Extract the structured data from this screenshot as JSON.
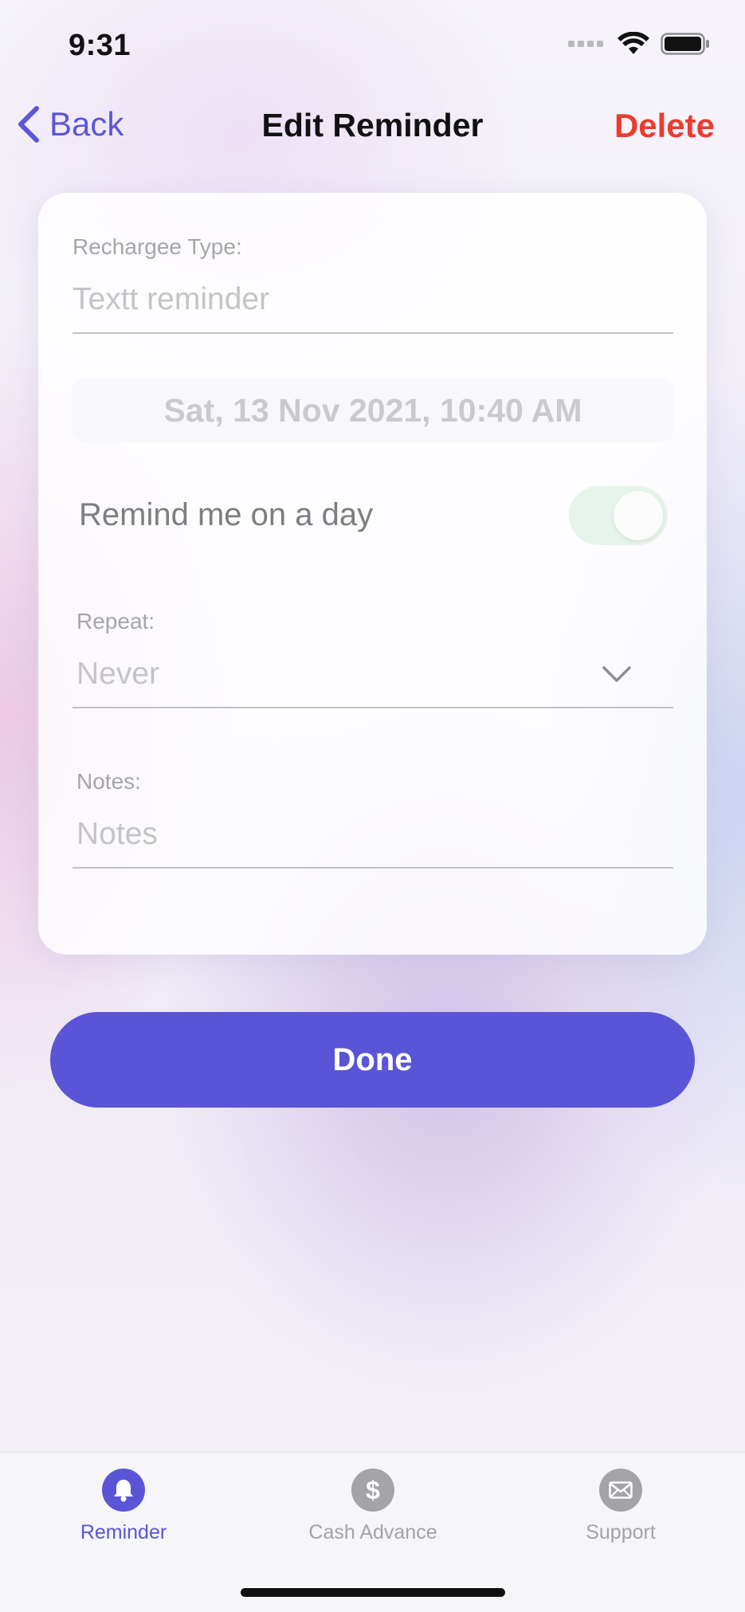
{
  "status_bar": {
    "time": "9:31"
  },
  "nav": {
    "back_label": "Back",
    "title": "Edit Reminder",
    "delete_label": "Delete"
  },
  "form": {
    "recharge_type_label": "Rechargee Type:",
    "recharge_type_placeholder": "Textt reminder",
    "date_time": "Sat, 13 Nov 2021, 10:40 AM",
    "remind_label": "Remind me on a day",
    "remind_toggle_on": true,
    "repeat_label": "Repeat:",
    "repeat_value": "Never",
    "notes_label": "Notes:",
    "notes_placeholder": "Notes"
  },
  "done_label": "Done",
  "tabs": [
    {
      "label": "Reminder",
      "icon": "bell-icon",
      "active": true
    },
    {
      "label": "Cash Advance",
      "icon": "dollar-icon",
      "active": false
    },
    {
      "label": "Support",
      "icon": "envelope-icon",
      "active": false
    }
  ],
  "colors": {
    "accent": "#5a55d6",
    "delete": "#ec3b2f",
    "tab_inactive": "#a3a3a8"
  }
}
